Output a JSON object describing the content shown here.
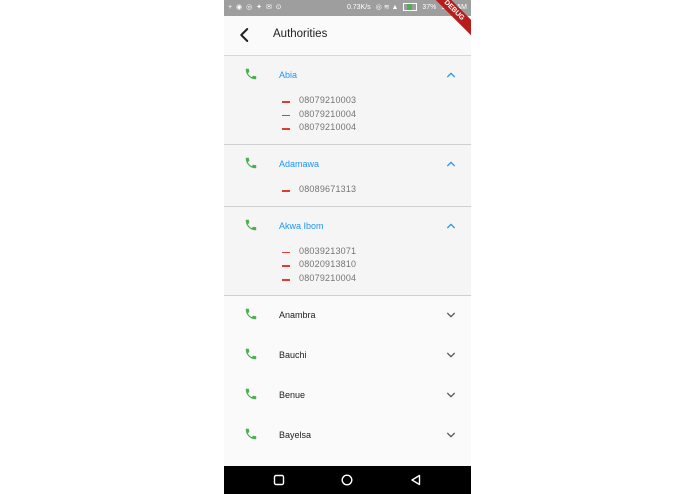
{
  "status_bar": {
    "network_speed": "0.73K/s",
    "battery_percent": "37%",
    "time": "9:28 AM",
    "battery_level": 0.37
  },
  "debug_banner": "DEBUG",
  "app_bar": {
    "title": "Authorities"
  },
  "groups": [
    {
      "name": "Abia",
      "expanded": true,
      "numbers": [
        "08079210003",
        "08079210004",
        "08079210004"
      ]
    },
    {
      "name": "Adamawa",
      "expanded": true,
      "numbers": [
        "08089671313"
      ]
    },
    {
      "name": "Akwa Ibom",
      "expanded": true,
      "numbers": [
        "08039213071",
        "08020913810",
        "08079210004"
      ]
    },
    {
      "name": "Anambra",
      "expanded": false,
      "numbers": []
    },
    {
      "name": "Bauchi",
      "expanded": false,
      "numbers": []
    },
    {
      "name": "Benue",
      "expanded": false,
      "numbers": []
    },
    {
      "name": "Bayelsa",
      "expanded": false,
      "numbers": []
    }
  ],
  "colors": {
    "accent": "#2196f3",
    "phone_icon": "#4caf50",
    "dash": "#e53935"
  },
  "icons": {
    "back": "arrow-back-icon",
    "phone": "phone-icon",
    "expand": "chevron-down-icon",
    "collapse": "chevron-up-icon",
    "nav_recents": "square-icon",
    "nav_home": "circle-icon",
    "nav_back": "triangle-back-icon"
  }
}
